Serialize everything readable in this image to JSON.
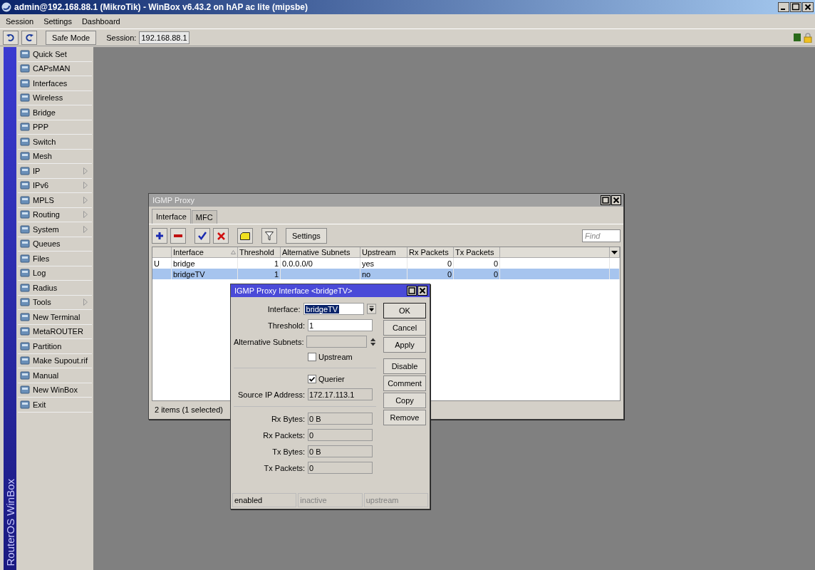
{
  "window": {
    "title": "admin@192.168.88.1 (MikroTik) - WinBox v6.43.2 on hAP ac lite (mipsbe)"
  },
  "menu": [
    "Session",
    "Settings",
    "Dashboard"
  ],
  "toolbar": {
    "safe_mode": "Safe Mode",
    "session_label": "Session:",
    "session_value": "192.168.88.1"
  },
  "sidebar": {
    "brand": "RouterOS WinBox",
    "items": [
      {
        "label": "Quick Set",
        "submenu": false
      },
      {
        "label": "CAPsMAN",
        "submenu": false
      },
      {
        "label": "Interfaces",
        "submenu": false
      },
      {
        "label": "Wireless",
        "submenu": false
      },
      {
        "label": "Bridge",
        "submenu": false
      },
      {
        "label": "PPP",
        "submenu": false
      },
      {
        "label": "Switch",
        "submenu": false
      },
      {
        "label": "Mesh",
        "submenu": false
      },
      {
        "label": "IP",
        "submenu": true
      },
      {
        "label": "IPv6",
        "submenu": true
      },
      {
        "label": "MPLS",
        "submenu": true
      },
      {
        "label": "Routing",
        "submenu": true
      },
      {
        "label": "System",
        "submenu": true
      },
      {
        "label": "Queues",
        "submenu": false
      },
      {
        "label": "Files",
        "submenu": false
      },
      {
        "label": "Log",
        "submenu": false
      },
      {
        "label": "Radius",
        "submenu": false
      },
      {
        "label": "Tools",
        "submenu": true
      },
      {
        "label": "New Terminal",
        "submenu": false
      },
      {
        "label": "MetaROUTER",
        "submenu": false
      },
      {
        "label": "Partition",
        "submenu": false
      },
      {
        "label": "Make Supout.rif",
        "submenu": false
      },
      {
        "label": "Manual",
        "submenu": false
      },
      {
        "label": "New WinBox",
        "submenu": false
      },
      {
        "label": "Exit",
        "submenu": false
      }
    ]
  },
  "igmp_window": {
    "title": "IGMP Proxy",
    "tabs": [
      {
        "label": "Interface",
        "selected": true
      },
      {
        "label": "MFC",
        "selected": false
      }
    ],
    "settings_button": "Settings",
    "find": {
      "placeholder": "Find"
    },
    "table": {
      "columns": [
        {
          "label": "Interface",
          "sorted": true
        },
        {
          "label": "Threshold",
          "sorted": false
        },
        {
          "label": "Alternative Subnets",
          "sorted": false
        },
        {
          "label": "Upstream",
          "sorted": false
        },
        {
          "label": "Rx Packets",
          "sorted": false
        },
        {
          "label": "Tx Packets",
          "sorted": false
        }
      ],
      "rows": [
        {
          "flag": "U",
          "cells": [
            "bridge",
            "1",
            "0.0.0.0/0",
            "yes",
            "0",
            "0"
          ],
          "selected": false
        },
        {
          "cells": [
            "bridgeTV",
            "1",
            "",
            "no",
            "0",
            "0"
          ],
          "selected": true
        }
      ]
    },
    "status": "2 items (1 selected)"
  },
  "dialog": {
    "title": "IGMP Proxy Interface <bridgeTV>",
    "fields": [
      {
        "kind": "select",
        "label": "Interface:",
        "value": "bridgeTV"
      },
      {
        "kind": "text",
        "label": "Threshold:",
        "value": "1"
      },
      {
        "kind": "spin",
        "label": "Alternative Subnets:"
      },
      {
        "kind": "checkbox",
        "label": "Upstream",
        "checked": false
      },
      {
        "kind": "separator"
      },
      {
        "kind": "checkbox",
        "label": "Querier",
        "checked": true
      },
      {
        "kind": "readonly",
        "label": "Source IP Address:",
        "value": "172.17.113.1"
      },
      {
        "kind": "separator"
      },
      {
        "kind": "readonly",
        "label": "Rx Bytes:",
        "value": "0 B"
      },
      {
        "kind": "readonly",
        "label": "Rx Packets:",
        "value": "0"
      },
      {
        "kind": "readonly",
        "label": "Tx Bytes:",
        "value": "0 B"
      },
      {
        "kind": "readonly",
        "label": "Tx Packets:",
        "value": "0"
      }
    ],
    "button_groups": [
      [
        "OK",
        "Cancel",
        "Apply"
      ],
      [
        "Disable",
        "Comment",
        "Copy",
        "Remove"
      ]
    ],
    "status": [
      {
        "label": "enabled",
        "dimmed": false
      },
      {
        "label": "inactive",
        "dimmed": true
      },
      {
        "label": "upstream",
        "dimmed": true
      }
    ]
  }
}
